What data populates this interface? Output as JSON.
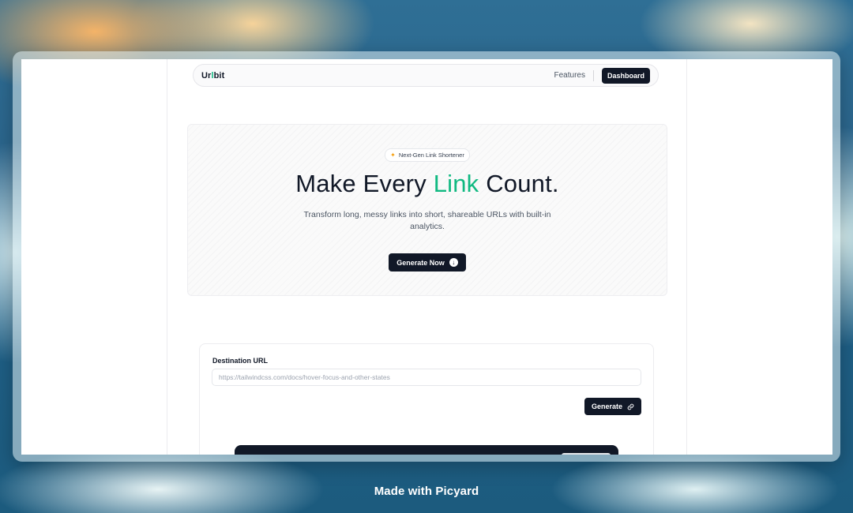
{
  "app": {
    "logo_prefix": "Ur",
    "logo_accent": "l",
    "logo_suffix": "bit"
  },
  "nav": {
    "features": "Features",
    "dashboard": "Dashboard"
  },
  "hero": {
    "badge_icon": "sparkles-icon",
    "badge": "Next-Gen Link Shortener",
    "headline_before": "Make Every ",
    "headline_highlight": "Link",
    "headline_after": " Count.",
    "subtitle": "Transform long, messy links into short, shareable URLs with built-in analytics.",
    "cta": "Generate Now",
    "cta_icon": "arrow-down-circle-icon"
  },
  "form": {
    "label": "Destination URL",
    "placeholder": "https://tailwindcss.com/docs/hover-focus-and-other-states",
    "value": "",
    "button": "Generate",
    "button_icon": "link-icon"
  },
  "footer": {
    "text": "Made with Picyard"
  },
  "colors": {
    "accent": "#10b981",
    "dark": "#111827"
  }
}
